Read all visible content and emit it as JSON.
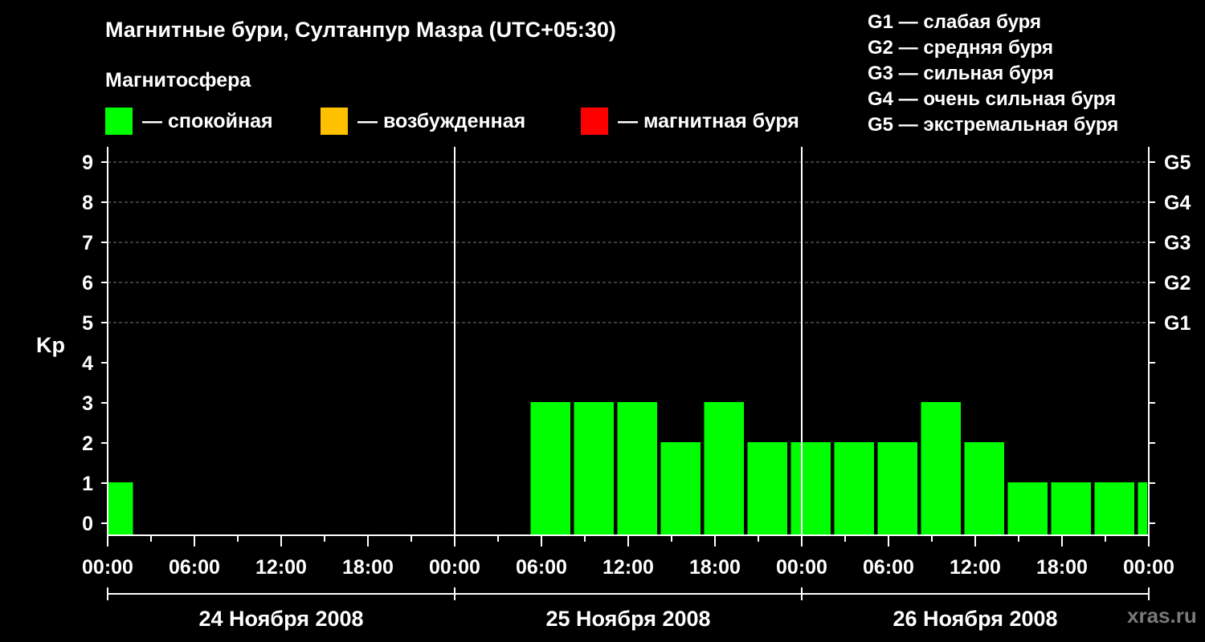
{
  "title": "Магнитные бури, Султанпур Мазра (UTC+05:30)",
  "subtitle": "Магнитосфера",
  "colors": {
    "background": "#000000",
    "quiet": "#00ff00",
    "active": "#ffc000",
    "storm": "#ff0000",
    "text": "#ffffff",
    "grid": "#777777",
    "watermark": "#7a7a7a"
  },
  "legend": [
    {
      "label": "— спокойная",
      "color": "#00ff00"
    },
    {
      "label": "— возбужденная",
      "color": "#ffc000"
    },
    {
      "label": "— магнитная буря",
      "color": "#ff0000"
    }
  ],
  "storm_scale": [
    "G1 — слабая буря",
    "G2 — средняя буря",
    "G3 — сильная буря",
    "G4 — очень сильная буря",
    "G5 — экстремальная буря"
  ],
  "watermark": "xras.ru",
  "chart_data": {
    "type": "bar",
    "ylabel": "Kp",
    "ylim": [
      0,
      9
    ],
    "yticks": [
      "0",
      "1",
      "2",
      "3",
      "4",
      "5",
      "6",
      "7",
      "8",
      "9"
    ],
    "right_ticks": [
      {
        "kp": 5,
        "label": "G1"
      },
      {
        "kp": 6,
        "label": "G2"
      },
      {
        "kp": 7,
        "label": "G3"
      },
      {
        "kp": 8,
        "label": "G4"
      },
      {
        "kp": 9,
        "label": "G5"
      }
    ],
    "x_range_hours": [
      0,
      72
    ],
    "xtick_labels": [
      "00:00",
      "06:00",
      "12:00",
      "18:00",
      "00:00",
      "06:00",
      "12:00",
      "18:00",
      "00:00",
      "06:00",
      "12:00",
      "18:00",
      "00:00"
    ],
    "days": [
      "24 Ноября 2008",
      "25 Ноября 2008",
      "26 Ноября 2008"
    ],
    "grid": true,
    "bars": [
      {
        "start": 0,
        "end": 1.75,
        "kp": 1
      },
      {
        "start": 29.25,
        "end": 32,
        "kp": 3
      },
      {
        "start": 32.25,
        "end": 35,
        "kp": 3
      },
      {
        "start": 35.25,
        "end": 38,
        "kp": 3
      },
      {
        "start": 38.25,
        "end": 41,
        "kp": 2
      },
      {
        "start": 41.25,
        "end": 44,
        "kp": 3
      },
      {
        "start": 44.25,
        "end": 47,
        "kp": 2
      },
      {
        "start": 47.25,
        "end": 50,
        "kp": 2
      },
      {
        "start": 50.25,
        "end": 53,
        "kp": 2
      },
      {
        "start": 53.25,
        "end": 56,
        "kp": 2
      },
      {
        "start": 56.25,
        "end": 59,
        "kp": 3
      },
      {
        "start": 59.25,
        "end": 62,
        "kp": 2
      },
      {
        "start": 62.25,
        "end": 65,
        "kp": 1
      },
      {
        "start": 65.25,
        "end": 68,
        "kp": 1
      },
      {
        "start": 68.25,
        "end": 71,
        "kp": 1
      },
      {
        "start": 71.25,
        "end": 71.9,
        "kp": 1
      }
    ]
  }
}
